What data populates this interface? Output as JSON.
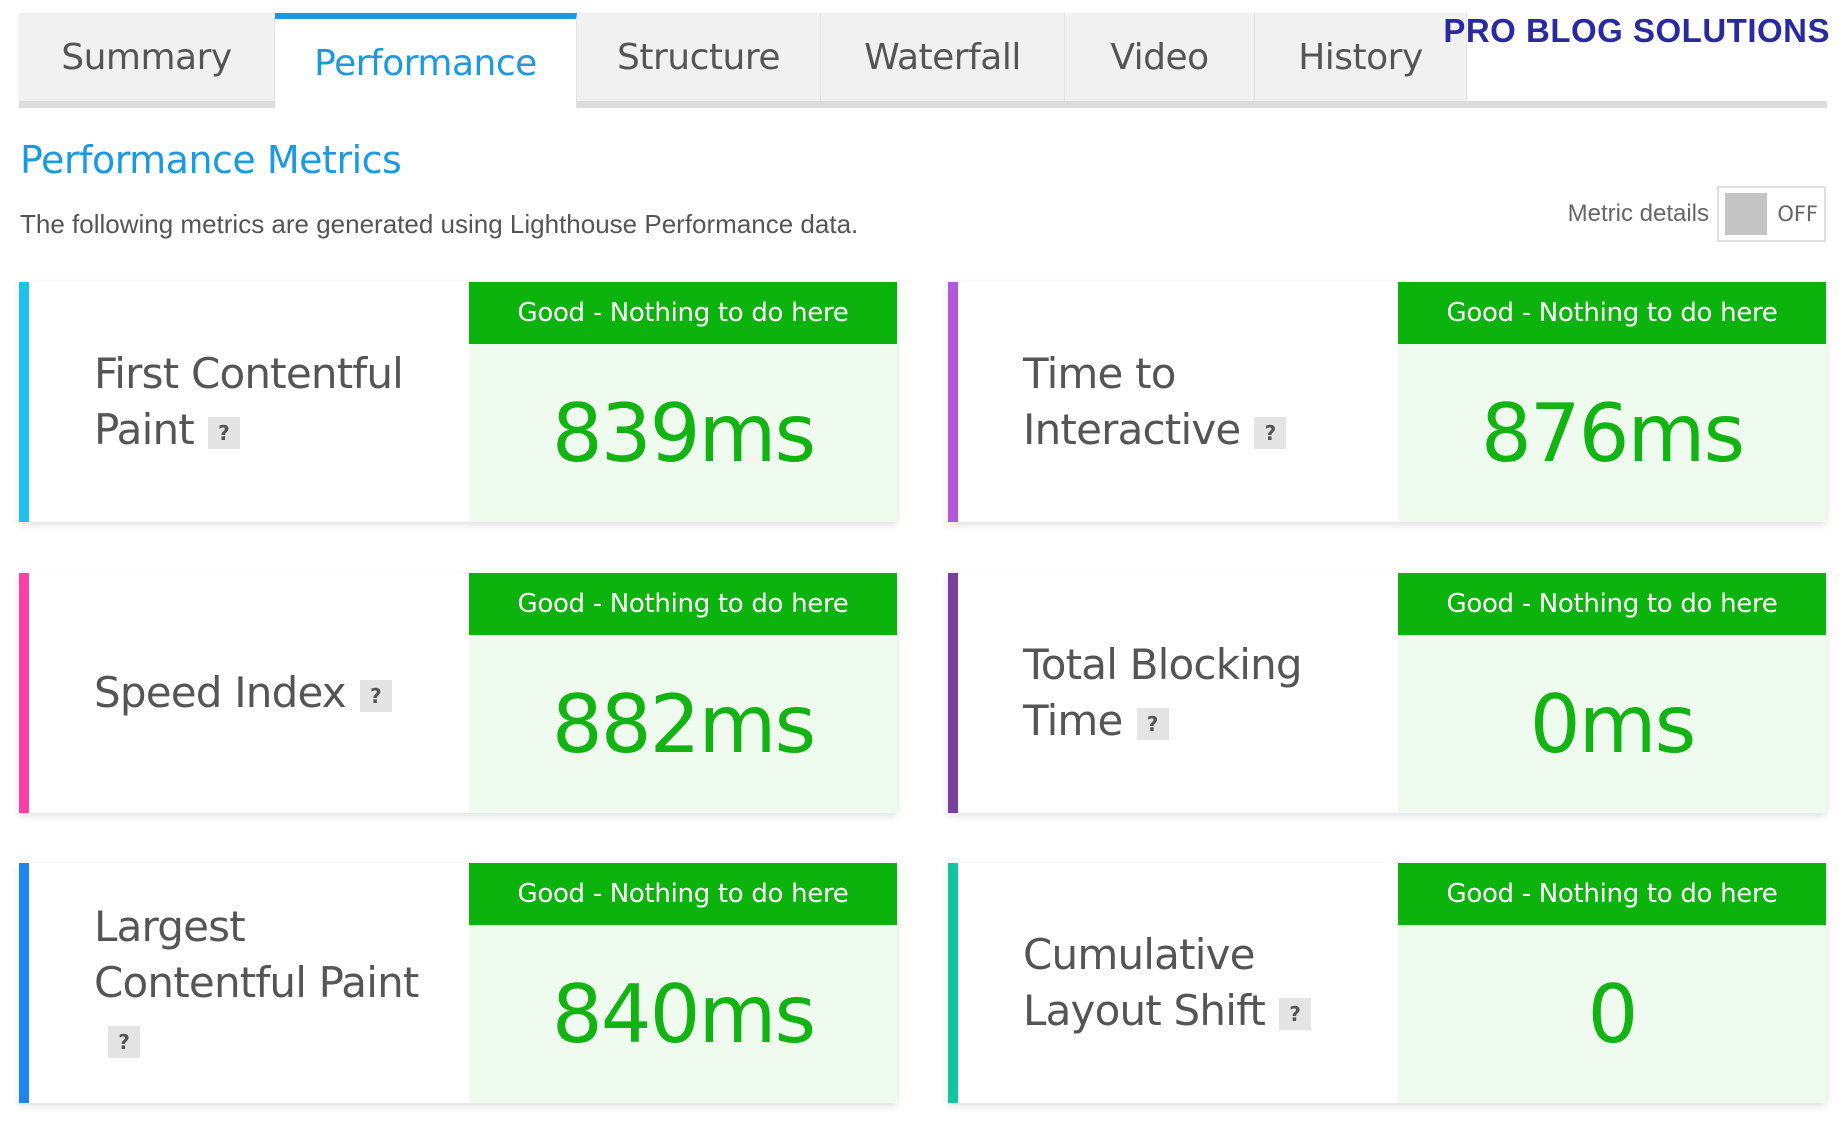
{
  "brand": "PRO BLOG SOLUTIONS",
  "tabs": [
    {
      "label": "Summary",
      "active": false
    },
    {
      "label": "Performance",
      "active": true
    },
    {
      "label": "Structure",
      "active": false
    },
    {
      "label": "Waterfall",
      "active": false
    },
    {
      "label": "Video",
      "active": false
    },
    {
      "label": "History",
      "active": false
    }
  ],
  "header": {
    "title": "Performance Metrics",
    "description": "The following metrics are generated using Lighthouse Performance data."
  },
  "metric_details": {
    "label": "Metric details",
    "state": "OFF"
  },
  "help_glyph": "?",
  "metrics": [
    {
      "label": "First Contentful Paint",
      "status": "Good - Nothing to do here",
      "value": "839ms",
      "stripe_color": "#1ec0f0"
    },
    {
      "label": "Time to Interactive",
      "status": "Good - Nothing to do here",
      "value": "876ms",
      "stripe_color": "#b05ad8"
    },
    {
      "label": "Speed Index",
      "status": "Good - Nothing to do here",
      "value": "882ms",
      "stripe_color": "#ff3ea8"
    },
    {
      "label": "Total Blocking Time",
      "status": "Good - Nothing to do here",
      "value": "0ms",
      "stripe_color": "#7a3f9a"
    },
    {
      "label": "Largest Contentful Paint",
      "status": "Good - Nothing to do here",
      "value": "840ms",
      "stripe_color": "#1e84f0"
    },
    {
      "label": "Cumulative Layout Shift",
      "status": "Good - Nothing to do here",
      "value": "0",
      "stripe_color": "#12c4a0"
    }
  ],
  "colors": {
    "accent": "#1b9ae2",
    "good": "#0db30d",
    "good_text": "#12b312",
    "brand": "#2a2aa0"
  }
}
